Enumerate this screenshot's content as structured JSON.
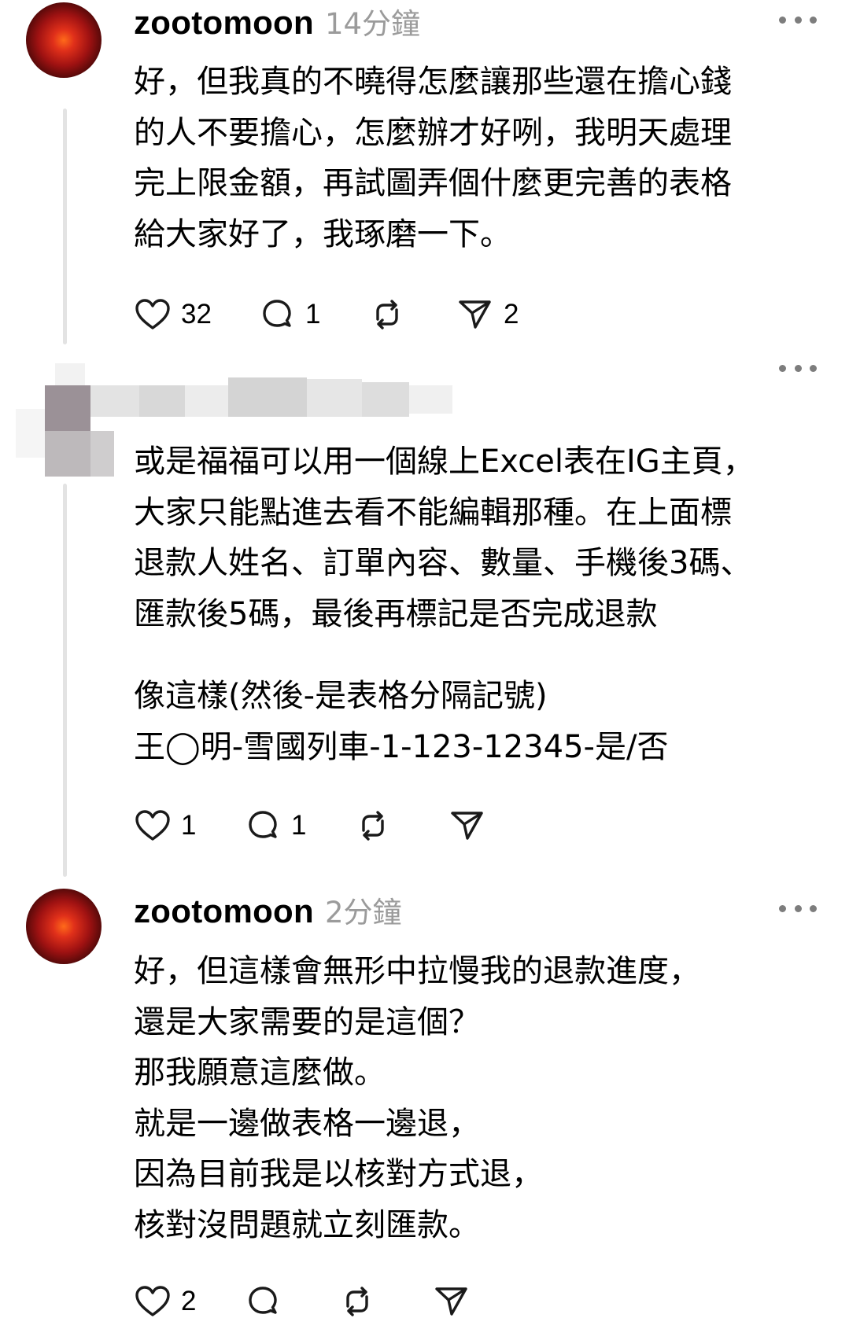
{
  "comments": [
    {
      "username": "zootomoon",
      "timestamp": "14分鐘",
      "lines": [
        "好，但我真的不曉得怎麼讓那些還在擔心錢",
        "的人不要擔心，怎麼辦才好咧，我明天處理",
        "完上限金額，再試圖弄個什麼更完善的表格",
        "給大家好了，我琢磨一下。"
      ],
      "likes": "32",
      "replies": "1",
      "reposts": "",
      "shares": "2"
    },
    {
      "username": "",
      "timestamp": "",
      "lines": [
        "或是福福可以用一個線上Excel表在IG主頁，",
        "大家只能點進去看不能編輯那種。在上面標",
        "退款人姓名、訂單內容、數量、手機後3碼、",
        "匯款後5碼，最後再標記是否完成退款"
      ],
      "lines2": [
        "像這樣(然後-是表格分隔記號)",
        "王◯明-雪國列車-1-123-12345-是/否"
      ],
      "likes": "1",
      "replies": "1",
      "reposts": "",
      "shares": ""
    },
    {
      "username": "zootomoon",
      "timestamp": "2分鐘",
      "lines": [
        "好，但這樣會無形中拉慢我的退款進度，",
        "還是大家需要的是這個？",
        "那我願意這麼做。",
        "就是一邊做表格一邊退，",
        "因為目前我是以核對方式退，",
        "核對沒問題就立刻匯款。"
      ],
      "likes": "2",
      "replies": "",
      "reposts": "",
      "shares": ""
    }
  ],
  "icons": {
    "like": "heart-icon",
    "reply": "comment-bubble-icon",
    "repost": "repost-icon",
    "share": "send-icon",
    "more": "more-dots-icon"
  },
  "colors": {
    "text": "#000000",
    "timestamp": "#9b9b9b",
    "thread_line": "#e3e3e3",
    "icon_stroke": "#1a1a1a"
  }
}
